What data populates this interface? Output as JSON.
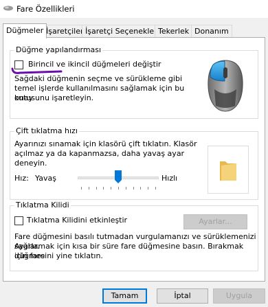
{
  "window": {
    "title": "Fare Özellikleri"
  },
  "tabs": [
    {
      "label": "Düğmeler",
      "active": true
    },
    {
      "label": "İşaretçiler",
      "active": false
    },
    {
      "label": "İşaretçi Seçenekleri",
      "active": false
    },
    {
      "label": "Tekerlek",
      "active": false
    },
    {
      "label": "Donanım",
      "active": false
    }
  ],
  "button_config": {
    "title": "Düğme yapılandırması",
    "checkbox_label": "Birincil ve ikincil düğmeleri değiştir",
    "checked": false,
    "description": [
      "Sağdaki düğmenin seçme ve sürükleme gibi",
      "temel işlerde kullanılmasını sağlamak için bu onay",
      "kutusunu işaretleyin."
    ]
  },
  "double_click": {
    "title": "Çift tıklatma hızı",
    "description": [
      "Ayarınızı sınamak için klasörü çift tıklatın. Klasör",
      "açılmaz ya da kapanmazsa, daha yavaş ayar",
      "deneyin."
    ],
    "speed_label": "Hız:",
    "slow_label": "Yavaş",
    "fast_label": "Hızlı",
    "speed_value": 0.5
  },
  "click_lock": {
    "title": "Tıklatma Kilidi",
    "checkbox_label": "Tıklatma Kilidini etkinleştir",
    "checked": false,
    "settings_button": "Ayarlar...",
    "description": [
      "Fare düğmesini basılı tutmadan vurgulamanızı ve sürüklemenizi sağlar.",
      "Ayarlamak için kısa bir süre fare düğmesine basın. Bırakmak için fare",
      "düğmesini yine tıklatın."
    ]
  },
  "footer": {
    "ok": "Tamam",
    "cancel": "İptal",
    "apply": "Uygula"
  },
  "colors": {
    "accent": "#0078d7",
    "mouse_button_highlight": "#1ea2e8",
    "annotation": "#6a0dad"
  }
}
